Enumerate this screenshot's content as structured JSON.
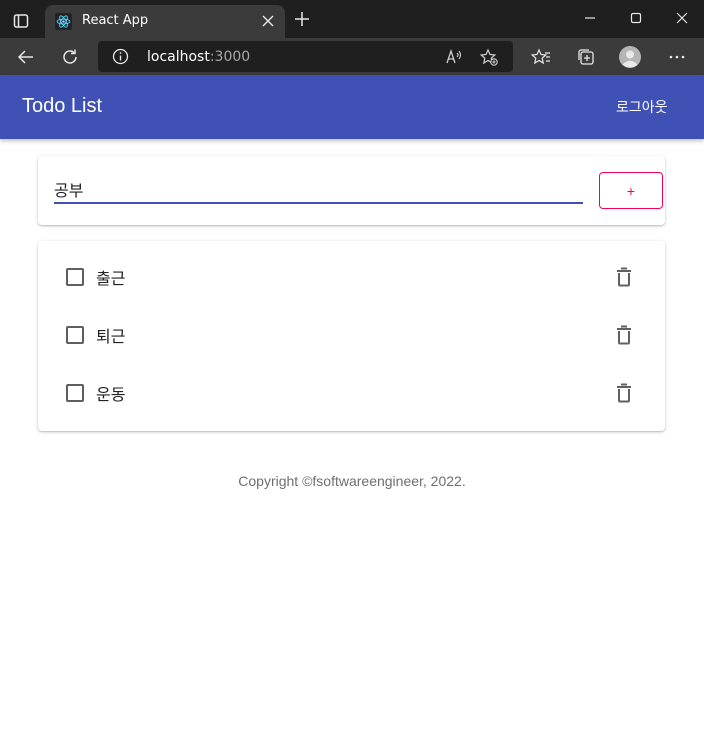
{
  "browser": {
    "tab_title": "React App",
    "url_host": "localhost",
    "url_port": ":3000"
  },
  "app": {
    "title": "Todo List",
    "logout_label": "로그아웃",
    "accent": "#3f51b5",
    "secondary": "#f50057"
  },
  "add_form": {
    "input_value": "공부",
    "add_label": "+"
  },
  "todos": [
    {
      "title": "출근",
      "done": false
    },
    {
      "title": "퇴근",
      "done": false
    },
    {
      "title": "운동",
      "done": false
    }
  ],
  "footer": {
    "copyright": "Copyright ©fsoftwareengineer, 2022."
  }
}
